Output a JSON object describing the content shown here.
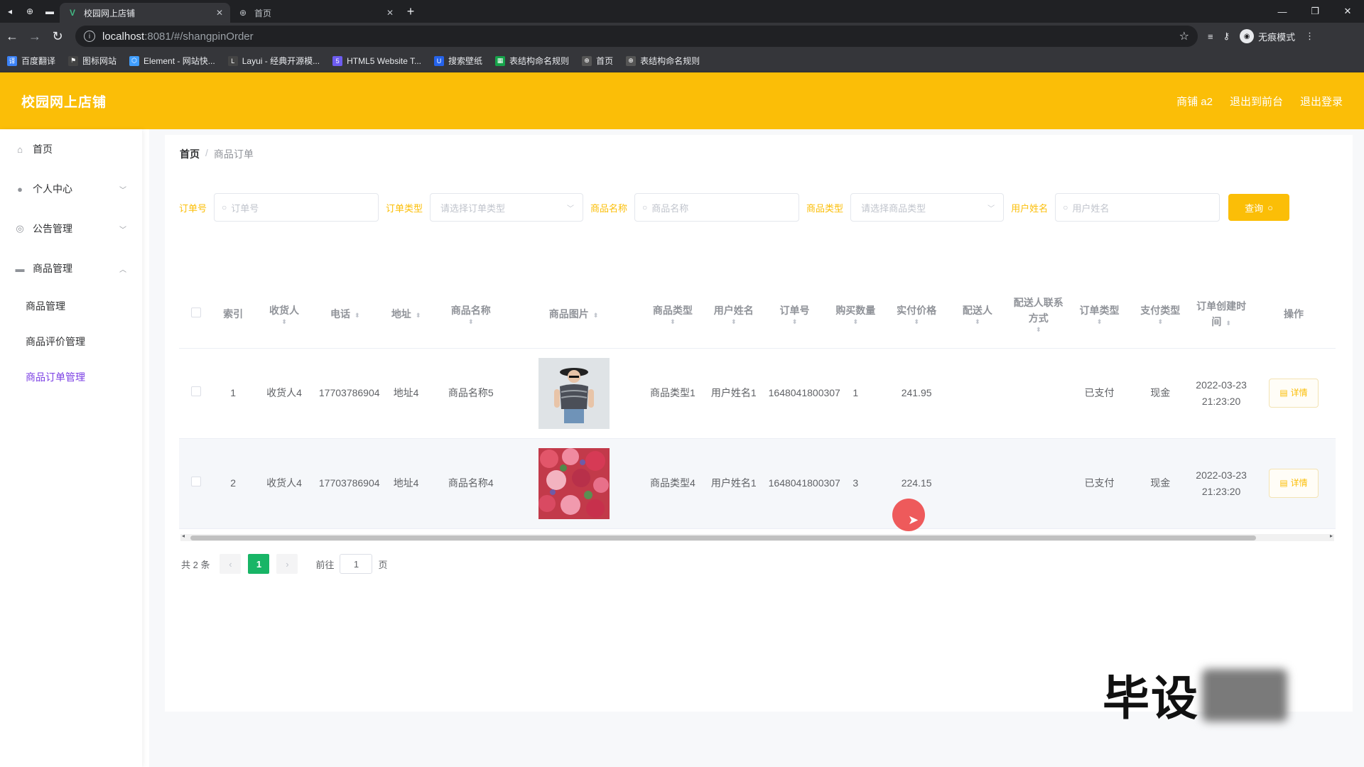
{
  "browser": {
    "tabs": [
      {
        "title": "校园网上店铺",
        "active": true
      },
      {
        "title": "首页",
        "active": false
      }
    ],
    "url_host": "localhost",
    "url_rest": ":8081/#/shangpinOrder",
    "incognito_label": "无痕模式",
    "bookmarks": [
      "百度翻译",
      "图标网站",
      "Element - 网站快...",
      "Layui - 经典开源模...",
      "HTML5 Website T...",
      "搜索壁纸",
      "表结构命名规则",
      "首页",
      "表结构命名规则"
    ]
  },
  "header": {
    "title": "校园网上店铺",
    "links": [
      "商铺 a2",
      "退出到前台",
      "退出登录"
    ]
  },
  "sidebar": {
    "items": [
      {
        "label": "首页",
        "icon": "home-icon"
      },
      {
        "label": "个人中心",
        "icon": "user-icon"
      },
      {
        "label": "公告管理",
        "icon": "compass-icon"
      },
      {
        "label": "商品管理",
        "icon": "chat-icon"
      }
    ],
    "sub_items": [
      {
        "label": "商品管理",
        "active": false
      },
      {
        "label": "商品评价管理",
        "active": false
      },
      {
        "label": "商品订单管理",
        "active": true
      }
    ]
  },
  "breadcrumb": {
    "home": "首页",
    "separator": "/",
    "current": "商品订单"
  },
  "filters": {
    "order_no_label": "订单号",
    "order_no_placeholder": "订单号",
    "order_type_label": "订单类型",
    "order_type_placeholder": "请选择订单类型",
    "product_name_label": "商品名称",
    "product_name_placeholder": "商品名称",
    "product_type_label": "商品类型",
    "product_type_placeholder": "请选择商品类型",
    "user_name_label": "用户姓名",
    "user_name_placeholder": "用户姓名",
    "search_button": "查询"
  },
  "table": {
    "headers": {
      "index": "索引",
      "receiver": "收货人",
      "phone": "电话",
      "address": "地址",
      "product_name": "商品名称",
      "product_image": "商品图片",
      "product_type": "商品类型",
      "user_name": "用户姓名",
      "order_no": "订单号",
      "quantity": "购买数量",
      "price": "实付价格",
      "courier": "配送人",
      "courier_contact": "配送人联系方式",
      "order_type": "订单类型",
      "pay_type": "支付类型",
      "created_at": "订单创建时间",
      "action": "操作"
    },
    "rows": [
      {
        "index": "1",
        "receiver": "收货人4",
        "phone": "17703786904",
        "address": "地址4",
        "product_name": "商品名称5",
        "image": "photo-person",
        "product_type": "商品类型1",
        "user_name": "用户姓名1",
        "order_no": "1648041800307",
        "quantity": "1",
        "price": "241.95",
        "courier": "",
        "courier_contact": "",
        "order_type": "已支付",
        "pay_type": "现金",
        "created_at": "2022-03-23 21:23:20",
        "action": "详情"
      },
      {
        "index": "2",
        "receiver": "收货人4",
        "phone": "17703786904",
        "address": "地址4",
        "product_name": "商品名称4",
        "image": "photo-flowers",
        "product_type": "商品类型4",
        "user_name": "用户姓名1",
        "order_no": "1648041800307",
        "quantity": "3",
        "price": "224.15",
        "courier": "",
        "courier_contact": "",
        "order_type": "已支付",
        "pay_type": "现金",
        "created_at": "2022-03-23 21:23:20",
        "action": "详情"
      }
    ]
  },
  "pagination": {
    "total_text": "共 2 条",
    "current_page": "1",
    "goto_label": "前往",
    "goto_value": "1",
    "page_suffix": "页"
  },
  "watermark": {
    "text": "毕设"
  },
  "colors": {
    "accent": "#fbbe07",
    "active_menu": "#7b3fe4",
    "page_active": "#18b566"
  }
}
